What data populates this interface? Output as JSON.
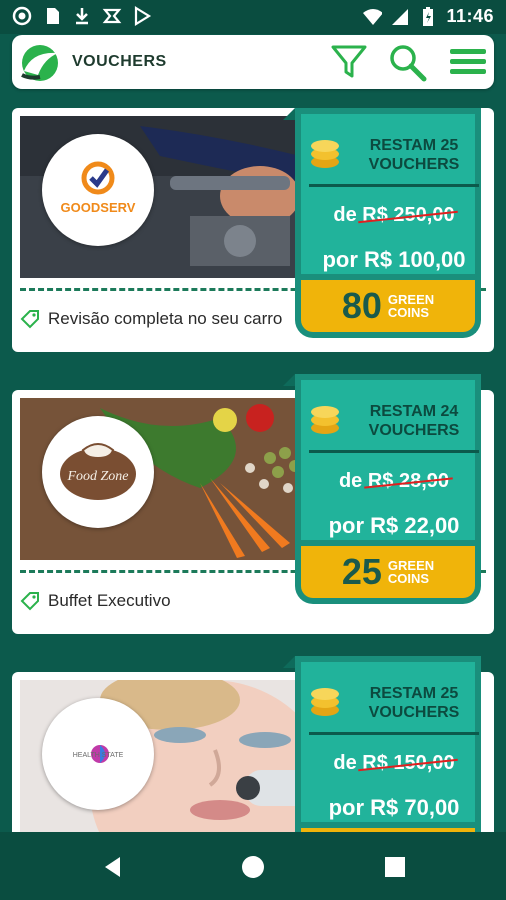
{
  "status_bar": {
    "time": "11:46",
    "icons": [
      "circle-notification-icon",
      "sd-card-icon",
      "download-icon",
      "app-icon",
      "play-store-icon",
      "wifi-icon",
      "signal-icon",
      "battery-icon"
    ]
  },
  "header": {
    "title": "VOUCHERS",
    "icons": [
      "app-logo-icon",
      "filter-icon",
      "search-icon",
      "menu-icon"
    ],
    "accent_color": "#2bb24c"
  },
  "vouchers": [
    {
      "brand": "GOODSERV",
      "brand_tagline": "",
      "remain_label_1": "RESTAM 25",
      "remain_label_2": "VOUCHERS",
      "old_prefix": "de",
      "old_price": "R$ 250,00",
      "new_price": "por R$ 100,00",
      "coins": "80",
      "coins_label_1": "GREEN",
      "coins_label_2": "COINS",
      "description": "Revisão completa no seu carro"
    },
    {
      "brand": "Food Zone",
      "brand_tagline": "",
      "remain_label_1": "RESTAM 24",
      "remain_label_2": "VOUCHERS",
      "old_prefix": "de",
      "old_price": "R$ 28,90",
      "new_price": "por R$ 22,00",
      "coins": "25",
      "coins_label_1": "GREEN",
      "coins_label_2": "COINS",
      "description": "Buffet Executivo"
    },
    {
      "brand": "HEALTH STATE",
      "brand_tagline": "",
      "remain_label_1": "RESTAM 25",
      "remain_label_2": "VOUCHERS",
      "old_prefix": "de",
      "old_price": "R$ 150,00",
      "new_price": "por R$ 70,00",
      "coins": "",
      "coins_label_1": "",
      "coins_label_2": "",
      "description": ""
    }
  ],
  "colors": {
    "background": "#0c5a4c",
    "panel_teal": "#21b39b",
    "panel_gold": "#f0b40a",
    "strike": "#e02020"
  },
  "nav_bar": {
    "icons": [
      "back-icon",
      "home-icon",
      "recents-icon"
    ]
  }
}
